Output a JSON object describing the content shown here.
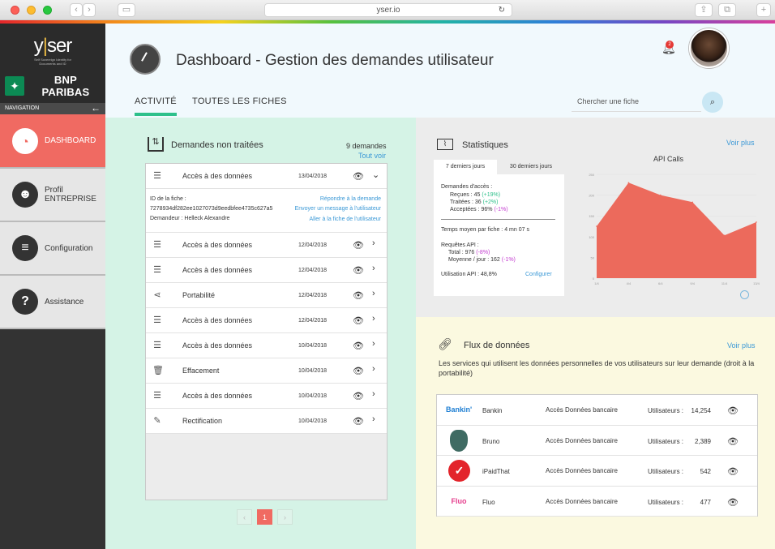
{
  "browser": {
    "url": "yser.io"
  },
  "sidebar": {
    "brand": "yser",
    "brand_tagline": "Self Sovereign Identity for Documents and ID",
    "partner": "BNP PARIBAS",
    "nav_header": "NAVIGATION",
    "items": [
      {
        "label": "DASHBOARD",
        "icon": "gauge-icon",
        "active": true
      },
      {
        "label": "Profil\nENTREPRISE",
        "icon": "team-icon",
        "active": false
      },
      {
        "label": "Configuration",
        "icon": "settings-sliders-icon",
        "active": false
      },
      {
        "label": "Assistance",
        "icon": "help-icon",
        "active": false
      }
    ]
  },
  "header": {
    "title": "Dashboard - Gestion des demandes utilisateur",
    "notification_count": "2",
    "tabs": [
      "ACTIVITÉ",
      "TOUTES LES FICHES"
    ],
    "search_placeholder": "Chercher une fiche"
  },
  "requests": {
    "title": "Demandes non traitées",
    "count": "9 demandes",
    "see_all": "Tout voir",
    "expanded": {
      "label": "Accès à des données",
      "date": "13/04/2018",
      "id_label": "ID de la fiche :",
      "id_value": "7278934df282ee1027073d9eedbfee4735c627a5",
      "requester": "Demandeur : Helleck Alexandre",
      "action1": "Répondre à la demande",
      "action2": "Envoyer un message à l'utilisateur",
      "action3": "Aller à la fiche de l'utilisateur"
    },
    "rows": [
      {
        "label": "Accès à des données",
        "date": "12/04/2018",
        "icon": "database-icon"
      },
      {
        "label": "Accès à des données",
        "date": "12/04/2018",
        "icon": "database-icon"
      },
      {
        "label": "Portabilité",
        "date": "12/04/2018",
        "icon": "share-icon"
      },
      {
        "label": "Accès à des données",
        "date": "12/04/2018",
        "icon": "database-icon"
      },
      {
        "label": "Accès à des données",
        "date": "10/04/2018",
        "icon": "database-icon"
      },
      {
        "label": "Effacement",
        "date": "10/04/2018",
        "icon": "trash-icon"
      },
      {
        "label": "Accès à des données",
        "date": "10/04/2018",
        "icon": "database-icon"
      },
      {
        "label": "Rectification",
        "date": "10/04/2018",
        "icon": "pencil-icon"
      }
    ],
    "pagination": {
      "current": "1"
    }
  },
  "stats": {
    "title": "Statistiques",
    "see_more": "Voir plus",
    "tabs": [
      "7 derniers jours",
      "30 derniers jours"
    ],
    "access_title": "Demandes d'accès :",
    "received": "Reçues : 45",
    "received_delta": "(+19%)",
    "processed": "Traitées : 36",
    "processed_delta": "(+2%)",
    "accepted": "Acceptées : 96%",
    "accepted_delta": "(-1%)",
    "avg_time": "Temps moyen par fiche : 4 mn 07 s",
    "api_title": "Requêtes API :",
    "api_total": "Total : 976",
    "api_total_delta": "(-8%)",
    "api_avg": "Moyenne / jour : 162",
    "api_avg_delta": "(-1%)",
    "api_usage": "Utilisation API : 48,8%",
    "configure": "Configurer"
  },
  "chart_data": {
    "type": "area",
    "title": "API Calls",
    "x": [
      "1/4",
      "4/4",
      "6/4",
      "9/4",
      "11/4",
      "13/4"
    ],
    "values": [
      125,
      230,
      200,
      183,
      103,
      135
    ],
    "ylim": [
      0,
      250
    ],
    "yticks": [
      0,
      50,
      100,
      150,
      200,
      250
    ],
    "color": "#ec6a5c"
  },
  "flux": {
    "title": "Flux de données",
    "see_more": "Voir plus",
    "description": "Les services qui utilisent les données personnelles de vos utilisateurs sur leur demande (droit à la portabilité)",
    "services": [
      {
        "name": "Bankin",
        "access": "Accès Données bancaire",
        "users_label": "Utilisateurs :",
        "users": "14,254",
        "logo": "Bankin'",
        "color": "#1f7fd3"
      },
      {
        "name": "Bruno",
        "access": "Accès Données bancaire",
        "users_label": "Utilisateurs :",
        "users": "2,389",
        "logo": "",
        "color": "#3f6b63"
      },
      {
        "name": "iPaidThat",
        "access": "Accès Données bancaire",
        "users_label": "Utilisateurs :",
        "users": "542",
        "logo": "✓",
        "color": "#e3242b"
      },
      {
        "name": "Fluo",
        "access": "Accès Données bancaire",
        "users_label": "Utilisateurs :",
        "users": "477",
        "logo": "Fluo",
        "color": "#e53d8c"
      }
    ]
  }
}
